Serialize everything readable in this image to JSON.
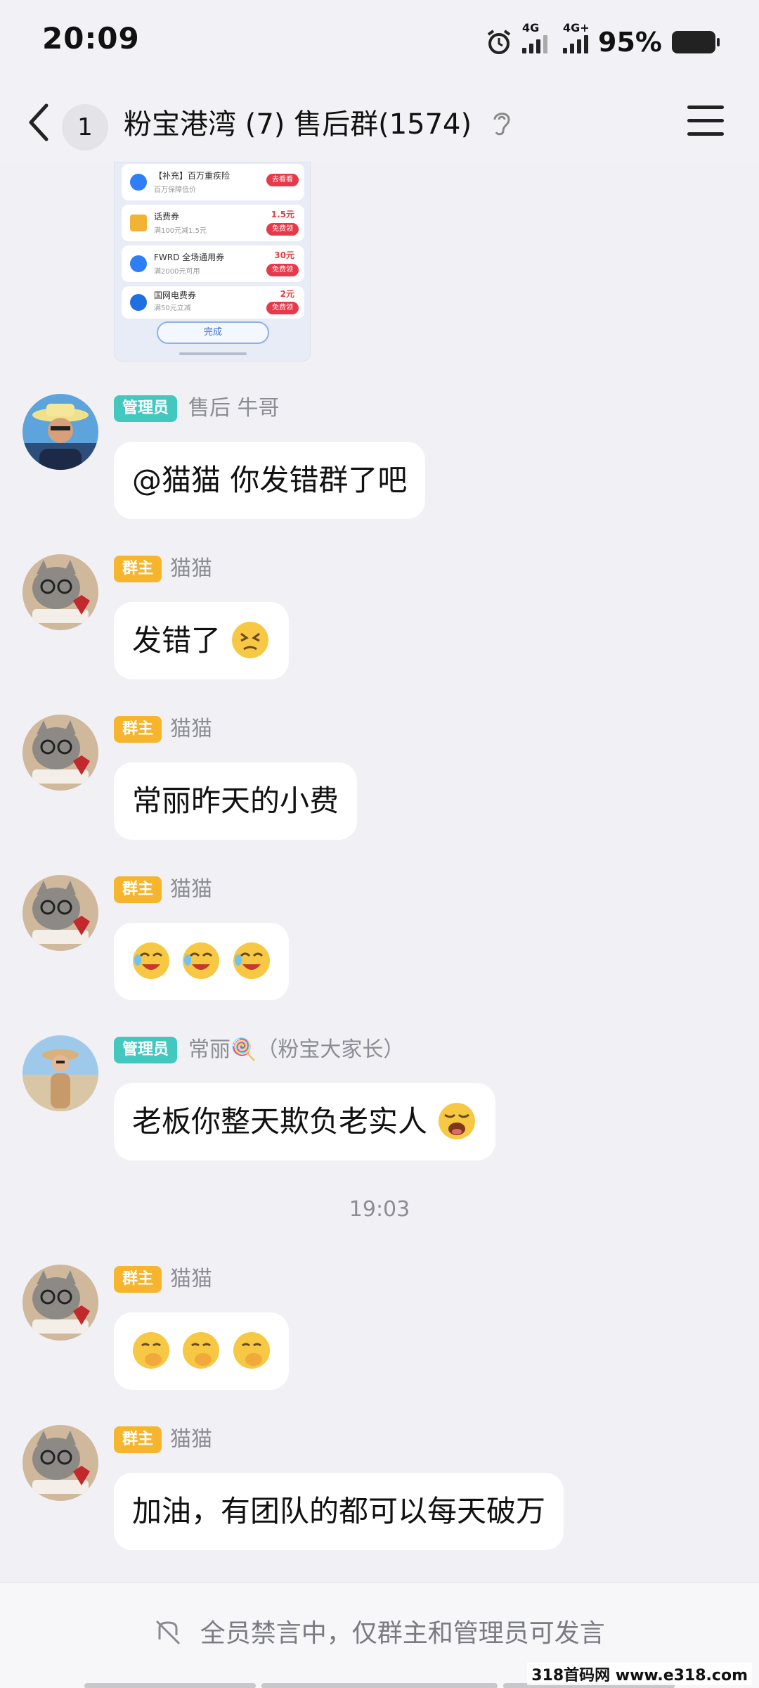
{
  "status_bar": {
    "time": "20:09",
    "network1": "4G",
    "network2": "4G+",
    "battery": "95%"
  },
  "header": {
    "unread_count": "1",
    "title": "粉宝港湾 (7) 售后群(1574)"
  },
  "shared_screenshot": {
    "rows": [
      {
        "title": "【补充】百万重疾险",
        "sub": "百万保障低价",
        "price": "",
        "button": "去看看"
      },
      {
        "title": "话费券",
        "sub": "满100元减1.5元",
        "price": "1.5元",
        "button": "免费领"
      },
      {
        "title": "FWRD 全场通用券",
        "sub": "满2000元可用",
        "price": "30元",
        "button": "免费领"
      },
      {
        "title": "国网电费券",
        "sub": "满50元立减",
        "price": "2元",
        "button": "免费领"
      }
    ],
    "done_label": "完成"
  },
  "messages": [
    {
      "role": "管理员",
      "role_type": "admin",
      "sender": "售后 牛哥",
      "text": "@猫猫 你发错群了吧"
    },
    {
      "role": "群主",
      "role_type": "owner",
      "sender": "猫猫",
      "text": "发错了",
      "emoji": "dizzy-face"
    },
    {
      "role": "群主",
      "role_type": "owner",
      "sender": "猫猫",
      "text": "常丽昨天的小费"
    },
    {
      "role": "群主",
      "role_type": "owner",
      "sender": "猫猫",
      "text": "",
      "emoji": "laugh-cry x3"
    },
    {
      "role": "管理员",
      "role_type": "admin",
      "sender": "常丽🍭（粉宝大家长）",
      "text": "老板你整天欺负老实人",
      "emoji": "crying-face"
    },
    {
      "role": "群主",
      "role_type": "owner",
      "sender": "猫猫",
      "text": "",
      "emoji": "hand-over-mouth x3"
    },
    {
      "role": "群主",
      "role_type": "owner",
      "sender": "猫猫",
      "text": "加油，有团队的都可以每天破万"
    }
  ],
  "timestamp": "19:03",
  "bottom": {
    "mute_notice": "全员禁言中，仅群主和管理员可发言"
  },
  "watermark": "318首码网 www.e318.com",
  "colors": {
    "admin_badge": "#43c8c0",
    "owner_badge": "#f6b52c",
    "background": "#f0f0f5",
    "bubble": "#ffffff"
  }
}
